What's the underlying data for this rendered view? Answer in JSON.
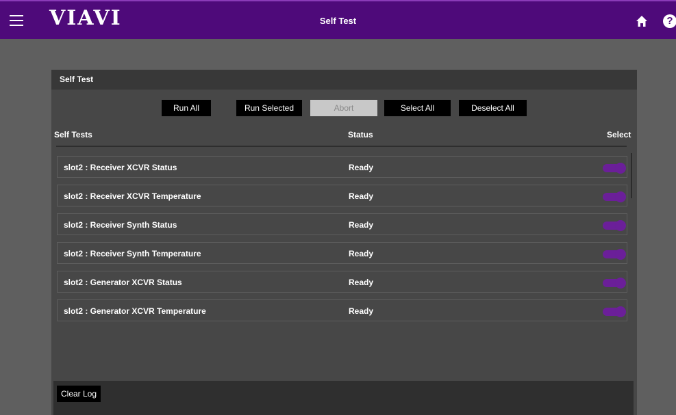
{
  "header": {
    "logo": "VIAVI",
    "title": "Self Test",
    "menu_icon": "hamburger-menu-icon",
    "home_icon": "home-icon",
    "help_icon": "help-icon",
    "help_glyph": "?"
  },
  "panel": {
    "title": "Self Test",
    "buttons": {
      "run_all": "Run All",
      "run_selected": "Run Selected",
      "abort": "Abort",
      "select_all": "Select All",
      "deselect_all": "Deselect All"
    },
    "columns": {
      "name": "Self Tests",
      "status": "Status",
      "select": "Select"
    },
    "tests": [
      {
        "name": "slot2 : Receiver XCVR Status",
        "status": "Ready",
        "selected": true
      },
      {
        "name": "slot2 : Receiver XCVR Temperature",
        "status": "Ready",
        "selected": true
      },
      {
        "name": "slot2 : Receiver Synth Status",
        "status": "Ready",
        "selected": true
      },
      {
        "name": "slot2 : Receiver Synth Temperature",
        "status": "Ready",
        "selected": true
      },
      {
        "name": "slot2 : Generator XCVR Status",
        "status": "Ready",
        "selected": true
      },
      {
        "name": "slot2 : Generator XCVR Temperature",
        "status": "Ready",
        "selected": true
      }
    ],
    "clear_log": "Clear Log"
  },
  "colors": {
    "header_bg": "#4e0a7a",
    "toggle_on": "#6b1f99",
    "panel_bg": "#474747"
  }
}
